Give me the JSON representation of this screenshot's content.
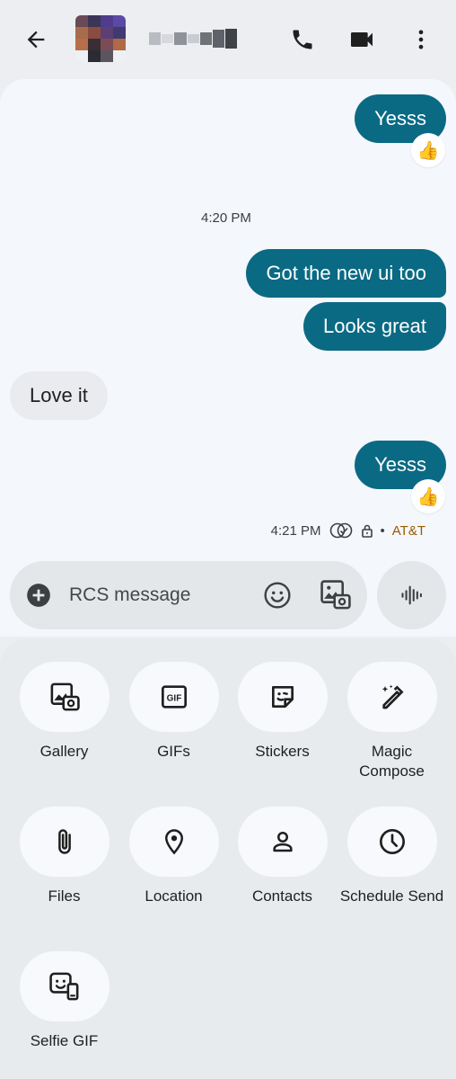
{
  "header": {
    "back_icon": "arrow-left-icon",
    "call_icon": "phone-icon",
    "video_icon": "video-camera-icon",
    "more_icon": "more-vertical-icon"
  },
  "conversation": {
    "messages": [
      {
        "direction": "outgoing",
        "text": "Yesss",
        "reaction": "👍"
      },
      {
        "type": "timestamp",
        "text": "4:20 PM"
      },
      {
        "direction": "outgoing",
        "text": "Got the new ui too"
      },
      {
        "direction": "outgoing",
        "text": "Looks great"
      },
      {
        "direction": "incoming",
        "text": "Love it"
      },
      {
        "direction": "outgoing",
        "text": "Yesss",
        "reaction": "👍"
      }
    ],
    "status": {
      "time": "4:21 PM",
      "carrier": "AT&T",
      "separator": "•"
    }
  },
  "compose": {
    "placeholder": "RCS message",
    "add_icon": "plus-circle-icon",
    "emoji_icon": "emoji-icon",
    "media_icon": "image-camera-icon",
    "voice_icon": "voice-waveform-icon"
  },
  "attachments": [
    {
      "label": "Gallery",
      "icon": "gallery-icon"
    },
    {
      "label": "GIFs",
      "icon": "gif-icon"
    },
    {
      "label": "Stickers",
      "icon": "sticker-icon"
    },
    {
      "label": "Magic Compose",
      "icon": "magic-pen-icon"
    },
    {
      "label": "Files",
      "icon": "paperclip-icon"
    },
    {
      "label": "Location",
      "icon": "location-pin-icon"
    },
    {
      "label": "Contacts",
      "icon": "person-icon"
    },
    {
      "label": "Schedule Send",
      "icon": "clock-icon"
    },
    {
      "label": "Selfie GIF",
      "icon": "selfie-gif-icon"
    }
  ],
  "colors": {
    "outgoing_bubble": "#0a6a84",
    "incoming_bubble": "#e9ebee",
    "carrier_text": "#9a5b00",
    "background": "#eceef1"
  }
}
